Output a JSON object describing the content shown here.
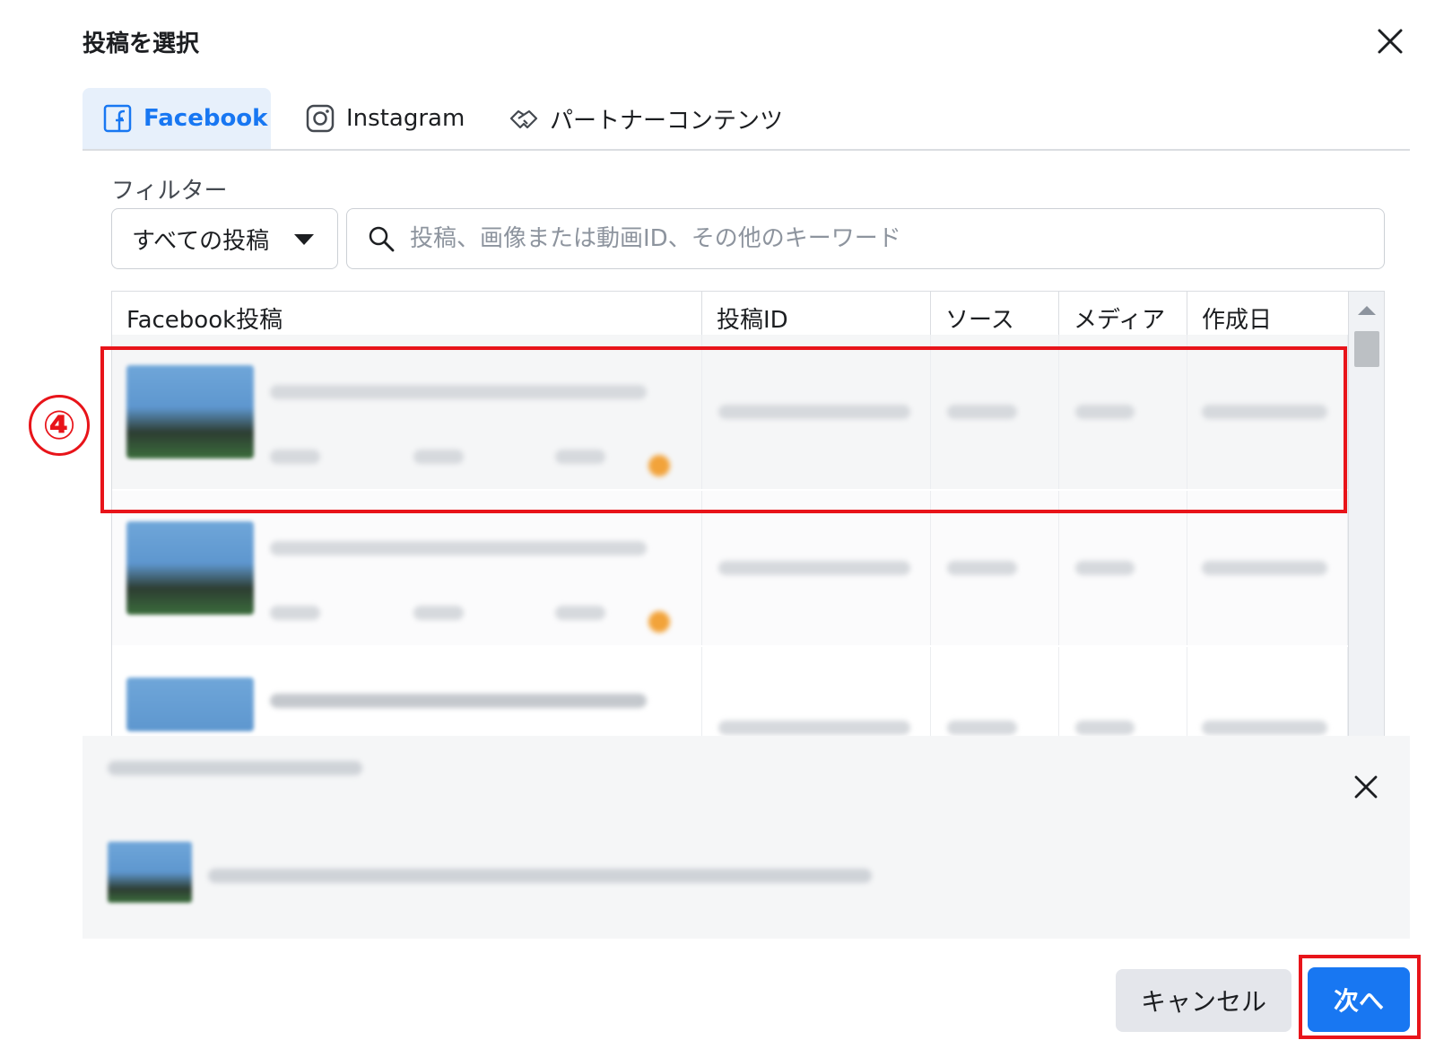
{
  "dialog": {
    "title": "投稿を選択",
    "close_icon": "close-icon"
  },
  "tabs": [
    {
      "label": "Facebook",
      "icon": "facebook-icon",
      "active": true
    },
    {
      "label": "Instagram",
      "icon": "instagram-icon",
      "active": false
    },
    {
      "label": "パートナーコンテンツ",
      "icon": "handshake-icon",
      "active": false
    }
  ],
  "filter": {
    "label": "フィルター",
    "dropdown_value": "すべての投稿",
    "search_placeholder": "投稿、画像または動画ID、その他のキーワード",
    "search_icon": "search-icon"
  },
  "table": {
    "columns": [
      "Facebook投稿",
      "投稿ID",
      "ソース",
      "メディア",
      "作成日"
    ],
    "rows_blurred": true
  },
  "annotation": {
    "number": "④",
    "color": "#e8141a"
  },
  "footer": {
    "cancel_label": "キャンセル",
    "next_label": "次へ"
  },
  "colors": {
    "accent": "#1877f2",
    "highlight": "#e8141a",
    "active_tab_bg": "#e7f0fb"
  }
}
